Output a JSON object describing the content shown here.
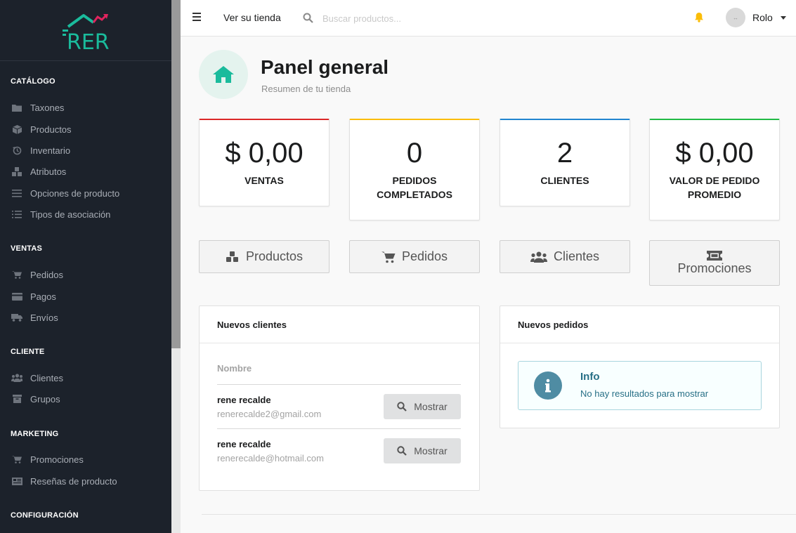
{
  "sidebar": {
    "logo_text": "RER",
    "sections": [
      {
        "title": "CATÁLOGO",
        "items": [
          {
            "label": "Taxones",
            "icon": "folder-icon"
          },
          {
            "label": "Productos",
            "icon": "cube-icon"
          },
          {
            "label": "Inventario",
            "icon": "history-icon"
          },
          {
            "label": "Atributos",
            "icon": "cubes-icon"
          },
          {
            "label": "Opciones de producto",
            "icon": "options-icon"
          },
          {
            "label": "Tipos de asociación",
            "icon": "tasks-icon"
          }
        ]
      },
      {
        "title": "VENTAS",
        "items": [
          {
            "label": "Pedidos",
            "icon": "cart-icon"
          },
          {
            "label": "Pagos",
            "icon": "payment-icon"
          },
          {
            "label": "Envíos",
            "icon": "truck-icon"
          }
        ]
      },
      {
        "title": "CLIENTE",
        "items": [
          {
            "label": "Clientes",
            "icon": "users-icon"
          },
          {
            "label": "Grupos",
            "icon": "archive-icon"
          }
        ]
      },
      {
        "title": "MARKETING",
        "items": [
          {
            "label": "Promociones",
            "icon": "cart-icon"
          },
          {
            "label": "Reseñas de producto",
            "icon": "newspaper-icon"
          }
        ]
      },
      {
        "title": "CONFIGURACIÓN",
        "items": []
      }
    ]
  },
  "topbar": {
    "store_link": "Ver su tienda",
    "search_placeholder": "Buscar productos...",
    "user_name": "Rolo"
  },
  "header": {
    "title": "Panel general",
    "subtitle": "Resumen de tu tienda"
  },
  "stats": [
    {
      "value": "$ 0,00",
      "label": "VENTAS",
      "color": "#db2828"
    },
    {
      "value": "0",
      "label": "PEDIDOS COMPLETADOS",
      "color": "#fbbd08"
    },
    {
      "value": "2",
      "label": "CLIENTES",
      "color": "#2185d0"
    },
    {
      "value": "$ 0,00",
      "label": "VALOR DE PEDIDO PROMEDIO",
      "color": "#21ba45"
    }
  ],
  "quick_links": [
    {
      "label": "Productos",
      "icon": "cubes-icon"
    },
    {
      "label": "Pedidos",
      "icon": "cart-icon"
    },
    {
      "label": "Clientes",
      "icon": "users-icon"
    },
    {
      "label": "Promociones",
      "icon": "ticket-icon"
    }
  ],
  "new_customers": {
    "title": "Nuevos clientes",
    "column": "Nombre",
    "button_label": "Mostrar",
    "rows": [
      {
        "name": "rene recalde",
        "email": "renerecalde2@gmail.com"
      },
      {
        "name": "rene recalde",
        "email": "renerecalde@hotmail.com"
      }
    ]
  },
  "new_orders": {
    "title": "Nuevos pedidos",
    "info_title": "Info",
    "info_message": "No hay resultados para mostrar"
  },
  "colors": {
    "accent": "#1abb9c",
    "sidebar_bg": "#1c222b"
  }
}
